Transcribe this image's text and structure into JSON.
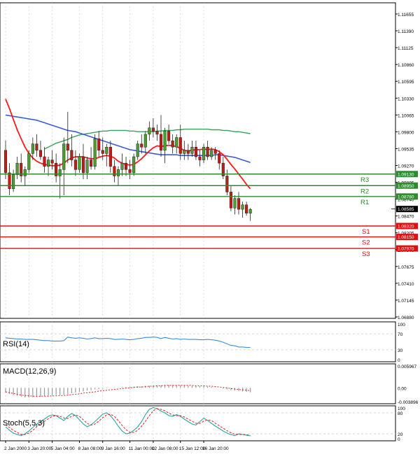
{
  "colors": {
    "background": "#ffffff",
    "grid": "#c8c8c8",
    "frame": "#000000",
    "candle_bull": "#4d9e2e",
    "candle_bear": "#c41b14",
    "ma_red": "#ff1a1a",
    "ma_blue": "#3b5bd9",
    "ma_green": "#3ea05a",
    "resistance": "#2e8b2e",
    "support": "#e01010",
    "rsi_line": "#3a8dde",
    "macd_hist": "#9a9a9a",
    "macd_signal": "#e02020",
    "stoch_main": "#2aa6a6",
    "stoch_signal": "#e02020"
  },
  "chart_data": [
    {
      "type": "candlestick",
      "panel": "price",
      "ylim": [
        1.0688,
        1.118
      ],
      "y_ticks": [
        "1.11655",
        "1.11390",
        "1.11125",
        "1.10860",
        "1.10595",
        "1.10330",
        "1.10065",
        "1.09800",
        "1.09535",
        "1.09270",
        "1.09005",
        "1.08740",
        "1.08470",
        "1.08205",
        "1.07940",
        "1.07675",
        "1.07410",
        "1.07145",
        "1.06880"
      ],
      "levels": [
        {
          "label": "R3",
          "value": "1.09130",
          "kind": "resistance"
        },
        {
          "label": "R2",
          "value": "1.08950",
          "kind": "resistance"
        },
        {
          "label": "R1",
          "value": "1.08780",
          "kind": "resistance"
        },
        {
          "label": "S1",
          "value": "1.08320",
          "kind": "support"
        },
        {
          "label": "S2",
          "value": "1.08150",
          "kind": "support"
        },
        {
          "label": "S3",
          "value": "1.07970",
          "kind": "support"
        }
      ],
      "current_price": "1.08585",
      "candles": [
        [
          1.095,
          1.0965,
          1.0905,
          1.0915
        ],
        [
          1.0915,
          1.093,
          1.088,
          1.089
        ],
        [
          1.089,
          1.092,
          1.0885,
          1.0912
        ],
        [
          1.0912,
          1.094,
          1.0905,
          1.093
        ],
        [
          1.093,
          1.0945,
          1.09,
          1.091
        ],
        [
          1.091,
          1.0925,
          1.0895,
          1.092
        ],
        [
          1.092,
          1.095,
          1.0915,
          1.0945
        ],
        [
          1.0945,
          1.097,
          1.0935,
          1.096
        ],
        [
          1.096,
          1.0975,
          1.094,
          1.095
        ],
        [
          1.095,
          1.0965,
          1.0935,
          1.094
        ],
        [
          1.094,
          1.0955,
          1.0915,
          1.0925
        ],
        [
          1.0925,
          1.094,
          1.091,
          1.0935
        ],
        [
          1.0935,
          1.095,
          1.092,
          1.093
        ],
        [
          1.093,
          1.0945,
          1.09,
          1.091
        ],
        [
          1.091,
          1.093,
          1.0875,
          1.092
        ],
        [
          1.092,
          1.097,
          1.088,
          1.096
        ],
        [
          1.096,
          1.101,
          1.093,
          1.095
        ],
        [
          1.095,
          1.0975,
          1.0925,
          1.0935
        ],
        [
          1.0935,
          1.095,
          1.091,
          1.092
        ],
        [
          1.092,
          1.0945,
          1.0915,
          1.094
        ],
        [
          1.094,
          1.096,
          1.0905,
          1.0915
        ],
        [
          1.0915,
          1.094,
          1.0905,
          1.0935
        ],
        [
          1.0935,
          1.0955,
          1.092,
          1.0925
        ],
        [
          1.0925,
          1.0975,
          1.092,
          1.0968
        ],
        [
          1.0968,
          1.098,
          1.094,
          1.095
        ],
        [
          1.095,
          1.097,
          1.0935,
          1.0945
        ],
        [
          1.0945,
          1.096,
          1.0925,
          1.0955
        ],
        [
          1.0955,
          1.0965,
          1.0915,
          1.0925
        ],
        [
          1.0925,
          1.0935,
          1.09,
          1.091
        ],
        [
          1.091,
          1.0925,
          1.0895,
          1.092
        ],
        [
          1.092,
          1.0945,
          1.091,
          1.093
        ],
        [
          1.093,
          1.094,
          1.091,
          1.092
        ],
        [
          1.092,
          1.0935,
          1.0905,
          1.0915
        ],
        [
          1.0915,
          1.0945,
          1.091,
          1.094
        ],
        [
          1.094,
          1.0965,
          1.0935,
          1.096
        ],
        [
          1.096,
          1.0975,
          1.0945,
          1.0955
        ],
        [
          1.0955,
          1.098,
          1.0945,
          1.0975
        ],
        [
          1.0975,
          1.0995,
          1.0965,
          1.0985
        ],
        [
          1.0985,
          1.1,
          1.097,
          1.098
        ],
        [
          1.098,
          1.099,
          1.0965,
          1.0975
        ],
        [
          1.0975,
          1.1005,
          1.094,
          1.095
        ],
        [
          1.095,
          1.0985,
          1.093,
          1.098
        ],
        [
          1.098,
          1.099,
          1.096,
          1.0965
        ],
        [
          1.0965,
          1.0975,
          1.0945,
          1.0955
        ],
        [
          1.0955,
          1.0975,
          1.0945,
          1.097
        ],
        [
          1.097,
          1.099,
          1.0935,
          1.0945
        ],
        [
          1.0945,
          1.0965,
          1.0935,
          1.095
        ],
        [
          1.095,
          1.096,
          1.0935,
          1.0945
        ],
        [
          1.0945,
          1.0965,
          1.094,
          1.0955
        ],
        [
          1.0955,
          1.0965,
          1.0935,
          1.094
        ],
        [
          1.094,
          1.095,
          1.0925,
          1.0935
        ],
        [
          1.0935,
          1.096,
          1.093,
          1.0955
        ],
        [
          1.0955,
          1.0965,
          1.0935,
          1.094
        ],
        [
          1.094,
          1.0955,
          1.0935,
          1.095
        ],
        [
          1.095,
          1.0955,
          1.0935,
          1.0945
        ],
        [
          1.0945,
          1.095,
          1.092,
          1.093
        ],
        [
          1.093,
          1.094,
          1.0905,
          1.091
        ],
        [
          1.091,
          1.092,
          1.088,
          1.0885
        ],
        [
          1.0885,
          1.0895,
          1.0855,
          1.086
        ],
        [
          1.086,
          1.088,
          1.085,
          1.0875
        ],
        [
          1.0875,
          1.0885,
          1.085,
          1.0858
        ],
        [
          1.0858,
          1.087,
          1.0845,
          1.0865
        ],
        [
          1.0865,
          1.087,
          1.0848,
          1.0852
        ],
        [
          1.0852,
          1.086,
          1.084,
          1.0858
        ]
      ],
      "ma_red": [
        1.103,
        1.1015,
        1.0998,
        1.0982,
        1.0968,
        1.0955,
        1.0945,
        1.0938,
        1.0933,
        1.093,
        1.0928,
        1.0927,
        1.0926,
        1.0926,
        1.0927,
        1.093,
        1.0935,
        1.0938,
        1.094,
        1.094,
        1.094,
        1.0938,
        1.0937,
        1.0937,
        1.0939,
        1.0941,
        1.0942,
        1.0941,
        1.0938,
        1.0933,
        1.093,
        1.0928,
        1.0927,
        1.0928,
        1.0932,
        1.0937,
        1.0943,
        1.0949,
        1.0954,
        1.0957,
        1.0956,
        1.0957,
        1.0958,
        1.0957,
        1.0956,
        1.0953,
        1.095,
        1.0949,
        1.095,
        1.0951,
        1.0951,
        1.0952,
        1.0951,
        1.0952,
        1.0951,
        1.0948,
        1.0943,
        1.0936,
        1.0928,
        1.0921,
        1.0913,
        1.0905,
        1.0897,
        1.089
      ],
      "ma_blue": [
        1.1005,
        1.1004,
        1.1003,
        1.1002,
        1.1001,
        1.1,
        1.0999,
        1.0998,
        1.0997,
        1.0995,
        1.0993,
        1.0991,
        1.0989,
        1.0987,
        1.0985,
        1.0983,
        1.0981,
        1.098,
        1.0979,
        1.0977,
        1.0975,
        1.0973,
        1.0971,
        1.0969,
        1.0967,
        1.0965,
        1.0963,
        1.0961,
        1.0959,
        1.0957,
        1.0955,
        1.0953,
        1.0951,
        1.095,
        1.0949,
        1.0948,
        1.0947,
        1.0946,
        1.0945,
        1.0944,
        1.0943,
        1.0943,
        1.0943,
        1.0943,
        1.0943,
        1.0942,
        1.0942,
        1.0942,
        1.0942,
        1.0942,
        1.0942,
        1.0942,
        1.0942,
        1.0942,
        1.0943,
        1.0943,
        1.0942,
        1.0941,
        1.094,
        1.0939,
        1.0937,
        1.0935,
        1.0933,
        1.0931
      ],
      "ma_green": [
        null,
        null,
        null,
        null,
        null,
        null,
        null,
        null,
        null,
        null,
        1.0952,
        1.0955,
        1.0958,
        1.0961,
        1.0963,
        1.0965,
        1.0967,
        1.097,
        1.0972,
        1.0974,
        1.0975,
        1.0976,
        1.0977,
        1.0978,
        1.0979,
        1.098,
        1.098,
        1.0981,
        1.0981,
        1.0981,
        1.0981,
        1.0981,
        1.098,
        1.098,
        1.0979,
        1.0979,
        1.0979,
        1.0979,
        1.0979,
        1.098,
        1.098,
        1.0981,
        1.0981,
        1.0981,
        1.0982,
        1.0982,
        1.0983,
        1.0983,
        1.0983,
        1.0983,
        1.0983,
        1.0983,
        1.0983,
        1.0982,
        1.0982,
        1.0982,
        1.0981,
        1.0981,
        1.098,
        1.0979,
        1.0979,
        1.0978,
        1.0977,
        1.0976
      ]
    },
    {
      "type": "line",
      "panel": "rsi",
      "name": "RSI(14)",
      "ylim": [
        0,
        100
      ],
      "y_ticks": [
        "100",
        "70",
        "30",
        "0"
      ],
      "values": [
        60,
        59,
        58,
        57,
        57,
        56,
        56,
        56,
        55,
        54,
        53,
        53,
        52,
        52,
        52,
        53,
        62,
        60,
        59,
        60,
        59,
        57,
        58,
        60,
        58,
        58,
        59,
        58,
        56,
        56,
        57,
        56,
        55,
        56,
        58,
        59,
        61,
        61,
        62,
        61,
        58,
        61,
        59,
        57,
        58,
        56,
        57,
        56,
        56,
        56,
        55,
        55,
        56,
        55,
        54,
        52,
        49,
        45,
        41,
        40,
        37,
        37,
        36,
        36
      ]
    },
    {
      "type": "bar",
      "panel": "macd",
      "name": "MACD(12,26,9)",
      "ylim": [
        -0.00396,
        0.005967
      ],
      "y_ticks": [
        "0.005967",
        "0.00",
        "-0.003896"
      ],
      "values": [
        -0.0012,
        -0.0015,
        -0.0018,
        -0.002,
        -0.0022,
        -0.0024,
        -0.0024,
        -0.0024,
        -0.0023,
        -0.0022,
        -0.0021,
        -0.002,
        -0.0019,
        -0.0018,
        -0.0018,
        -0.0017,
        -0.0015,
        -0.0013,
        -0.0012,
        -0.001,
        -0.0009,
        -0.0007,
        -0.0006,
        -0.0004,
        -0.0003,
        -0.0002,
        -0.0001,
        0.0,
        0.0001,
        0.0001,
        0.0002,
        0.0002,
        0.0003,
        0.0003,
        0.0004,
        0.0004,
        0.0005,
        0.0005,
        0.0006,
        0.0006,
        0.0006,
        0.0007,
        0.0007,
        0.0007,
        0.0006,
        0.0006,
        0.0006,
        0.0005,
        0.0005,
        0.0005,
        0.0004,
        0.0004,
        0.0003,
        0.0002,
        0.0001,
        0.0,
        -0.0002,
        -0.0004,
        -0.0006,
        -0.0007,
        -0.0008,
        -0.0009,
        -0.001,
        -0.0011
      ],
      "signal": [
        -0.001,
        -0.0012,
        -0.0014,
        -0.0016,
        -0.0018,
        -0.0019,
        -0.002,
        -0.0021,
        -0.0021,
        -0.0021,
        -0.0021,
        -0.0021,
        -0.002,
        -0.002,
        -0.0019,
        -0.0019,
        -0.0018,
        -0.0017,
        -0.0016,
        -0.0015,
        -0.0013,
        -0.0012,
        -0.0011,
        -0.001,
        -0.0008,
        -0.0007,
        -0.0006,
        -0.0005,
        -0.0004,
        -0.0003,
        -0.0002,
        -0.0001,
        0.0,
        0.0001,
        0.0002,
        0.0002,
        0.0003,
        0.0004,
        0.0004,
        0.0005,
        0.0005,
        0.0006,
        0.0006,
        0.0006,
        0.0006,
        0.0006,
        0.0006,
        0.0006,
        0.0006,
        0.0005,
        0.0005,
        0.0005,
        0.0004,
        0.0004,
        0.0003,
        0.0002,
        0.0001,
        -0.0,
        -0.0002,
        -0.0003,
        -0.0004,
        -0.0005,
        -0.0006,
        -0.0007
      ]
    },
    {
      "type": "line",
      "panel": "stoch",
      "name": "Stoch(5,5,3)",
      "ylim": [
        0,
        100
      ],
      "y_ticks": [
        "100",
        "80",
        "20",
        "0"
      ],
      "main": [
        40,
        30,
        22,
        18,
        15,
        20,
        28,
        38,
        48,
        55,
        62,
        70,
        74,
        72,
        65,
        58,
        70,
        78,
        72,
        60,
        48,
        40,
        46,
        55,
        66,
        76,
        80,
        72,
        58,
        42,
        28,
        20,
        22,
        30,
        40,
        55,
        75,
        90,
        95,
        92,
        85,
        80,
        72,
        70,
        75,
        70,
        62,
        55,
        48,
        45,
        55,
        65,
        58,
        50,
        42,
        35,
        28,
        22,
        18,
        15,
        20,
        18,
        16,
        14
      ],
      "signal": [
        46,
        38,
        30,
        24,
        18,
        18,
        22,
        30,
        40,
        48,
        56,
        63,
        70,
        72,
        70,
        65,
        64,
        70,
        74,
        70,
        60,
        50,
        45,
        48,
        56,
        66,
        74,
        76,
        70,
        58,
        44,
        32,
        24,
        24,
        30,
        42,
        56,
        72,
        86,
        92,
        90,
        86,
        79,
        74,
        72,
        72,
        68,
        62,
        56,
        50,
        50,
        56,
        60,
        58,
        50,
        43,
        36,
        29,
        23,
        19,
        18,
        18,
        17,
        16
      ]
    }
  ],
  "x_labels": [
    "2 Jan 2000",
    "3 Jan 20:00",
    "5 Jan 04:00",
    "8 Jan 08:00",
    "9 Jan 16:00",
    "11 Jan 00:00",
    "12 Jan 08:00",
    "15 Jan 12:00",
    "16 Jan 20:00"
  ],
  "x_label_positions": [
    0,
    6,
    12,
    19,
    25,
    32,
    38,
    45,
    51
  ]
}
